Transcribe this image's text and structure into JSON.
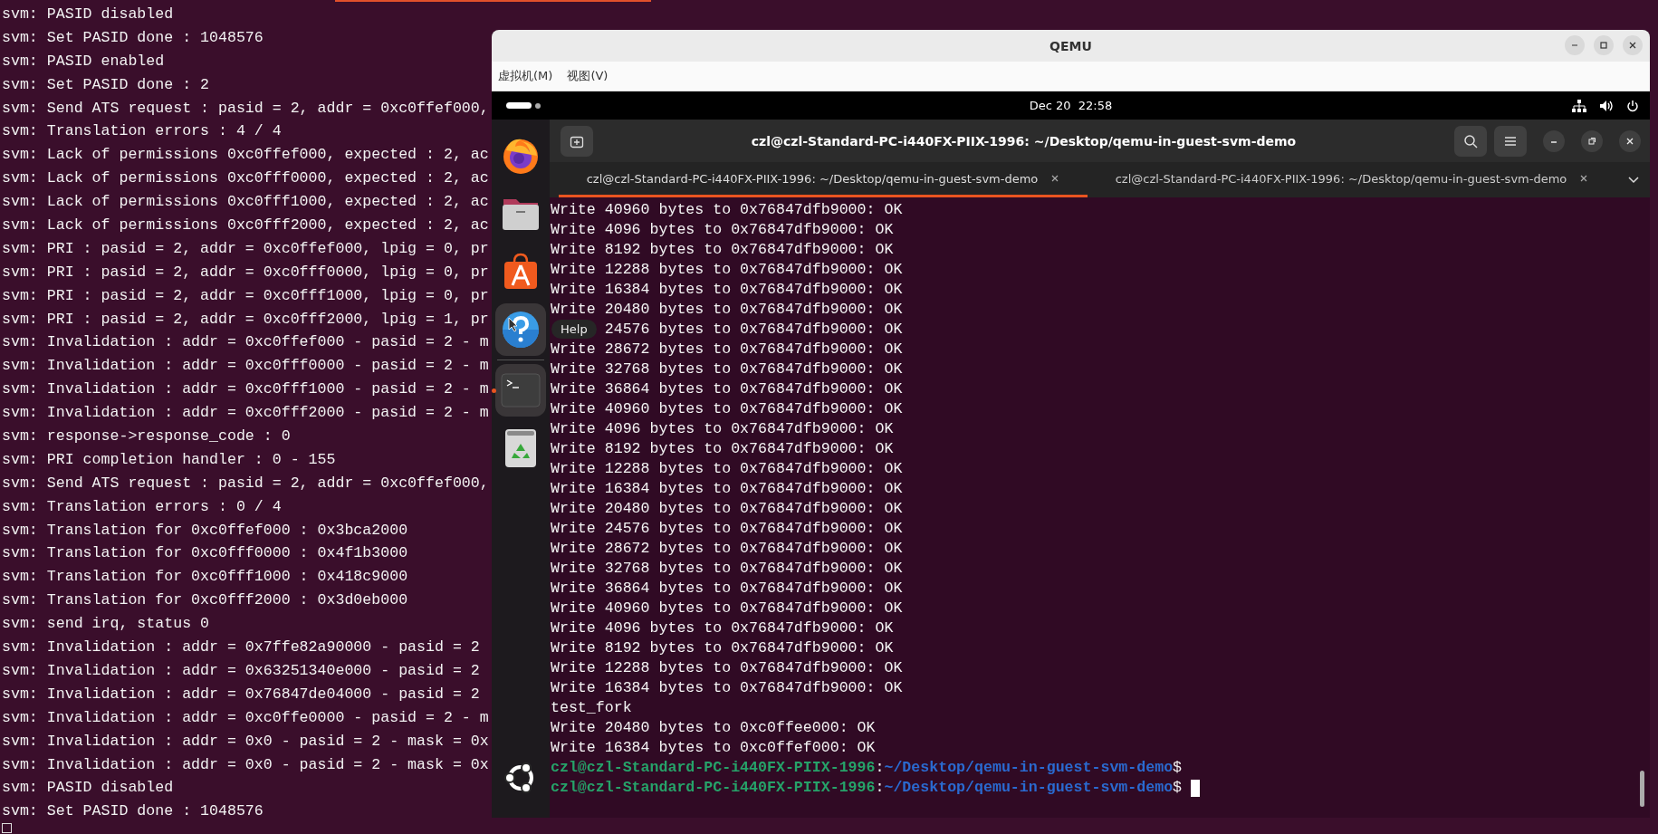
{
  "host_terminal": {
    "lines": [
      "svm: PASID disabled",
      "svm: Set PASID done : 1048576",
      "svm: PASID enabled",
      "svm: Set PASID done : 2",
      "svm: Send ATS request : pasid = 2, addr = 0xc0ffef000,",
      "svm: Translation errors : 4 / 4",
      "svm: Lack of permissions 0xc0ffef000, expected : 2, ac",
      "svm: Lack of permissions 0xc0fff0000, expected : 2, ac",
      "svm: Lack of permissions 0xc0fff1000, expected : 2, ac",
      "svm: Lack of permissions 0xc0fff2000, expected : 2, ac",
      "svm: PRI : pasid = 2, addr = 0xc0ffef000, lpig = 0, pr",
      "svm: PRI : pasid = 2, addr = 0xc0fff0000, lpig = 0, pr",
      "svm: PRI : pasid = 2, addr = 0xc0fff1000, lpig = 0, pr",
      "svm: PRI : pasid = 2, addr = 0xc0fff2000, lpig = 1, pr",
      "svm: Invalidation : addr = 0xc0ffef000 - pasid = 2 - m",
      "svm: Invalidation : addr = 0xc0fff0000 - pasid = 2 - m",
      "svm: Invalidation : addr = 0xc0fff1000 - pasid = 2 - m",
      "svm: Invalidation : addr = 0xc0fff2000 - pasid = 2 - m",
      "svm: response->response_code : 0",
      "svm: PRI completion handler : 0 - 155",
      "svm: Send ATS request : pasid = 2, addr = 0xc0ffef000,",
      "svm: Translation errors : 0 / 4",
      "svm: Translation for 0xc0ffef000 : 0x3bca2000",
      "svm: Translation for 0xc0fff0000 : 0x4f1b3000",
      "svm: Translation for 0xc0fff1000 : 0x418c9000",
      "svm: Translation for 0xc0fff2000 : 0x3d0eb000",
      "svm: send irq, status 0",
      "svm: Invalidation : addr = 0x7ffe82a90000 - pasid = 2",
      "svm: Invalidation : addr = 0x63251340e000 - pasid = 2",
      "svm: Invalidation : addr = 0x76847de04000 - pasid = 2",
      "svm: Invalidation : addr = 0xc0ffe0000 - pasid = 2 - m",
      "svm: Invalidation : addr = 0x0 - pasid = 2 - mask = 0x",
      "svm: Invalidation : addr = 0x0 - pasid = 2 - mask = 0x",
      "svm: PASID disabled",
      "svm: Set PASID done : 1048576"
    ]
  },
  "qemu": {
    "title": "QEMU",
    "menu": [
      {
        "label": "虚拟机(M)"
      },
      {
        "label": "视图(V)"
      }
    ],
    "guest": {
      "clock": "Dec 20  22:58",
      "dock": [
        {
          "kind": "browser",
          "highlighted": false,
          "running": false
        },
        {
          "kind": "files",
          "highlighted": false,
          "running": false
        },
        {
          "kind": "store",
          "highlighted": false,
          "running": false
        },
        {
          "kind": "help",
          "highlighted": true,
          "running": false
        },
        {
          "kind": "terminal",
          "highlighted": true,
          "running": true
        },
        {
          "kind": "trash",
          "highlighted": false,
          "running": false
        }
      ],
      "tooltip": "Help",
      "terminal": {
        "title": "czl@czl-Standard-PC-i440FX-PIIX-1996: ~/Desktop/qemu-in-guest-svm-demo",
        "tabs": [
          {
            "label": "czl@czl-Standard-PC-i440FX-PIIX-1996: ~/Desktop/qemu-in-guest-svm-demo",
            "selected": true
          },
          {
            "label": "czl@czl-Standard-PC-i440FX-PIIX-1996: ~/Desktop/qemu-in-guest-svm-demo",
            "selected": false
          }
        ],
        "lines": [
          {
            "kind": "output",
            "text": "Write 40960 bytes to 0x76847dfb9000: OK"
          },
          {
            "kind": "output",
            "text": "Write 4096 bytes to 0x76847dfb9000: OK"
          },
          {
            "kind": "output",
            "text": "Write 8192 bytes to 0x76847dfb9000: OK"
          },
          {
            "kind": "output",
            "text": "Write 12288 bytes to 0x76847dfb9000: OK"
          },
          {
            "kind": "output",
            "text": "Write 16384 bytes to 0x76847dfb9000: OK"
          },
          {
            "kind": "output",
            "text": "Write 20480 bytes to 0x76847dfb9000: OK"
          },
          {
            "kind": "covered",
            "text": "24576 bytes to 0x76847dfb9000: OK"
          },
          {
            "kind": "output",
            "text": "Write 28672 bytes to 0x76847dfb9000: OK"
          },
          {
            "kind": "output",
            "text": "Write 32768 bytes to 0x76847dfb9000: OK"
          },
          {
            "kind": "output",
            "text": "Write 36864 bytes to 0x76847dfb9000: OK"
          },
          {
            "kind": "output",
            "text": "Write 40960 bytes to 0x76847dfb9000: OK"
          },
          {
            "kind": "output",
            "text": "Write 4096 bytes to 0x76847dfb9000: OK"
          },
          {
            "kind": "output",
            "text": "Write 8192 bytes to 0x76847dfb9000: OK"
          },
          {
            "kind": "output",
            "text": "Write 12288 bytes to 0x76847dfb9000: OK"
          },
          {
            "kind": "output",
            "text": "Write 16384 bytes to 0x76847dfb9000: OK"
          },
          {
            "kind": "output",
            "text": "Write 20480 bytes to 0x76847dfb9000: OK"
          },
          {
            "kind": "output",
            "text": "Write 24576 bytes to 0x76847dfb9000: OK"
          },
          {
            "kind": "output",
            "text": "Write 28672 bytes to 0x76847dfb9000: OK"
          },
          {
            "kind": "output",
            "text": "Write 32768 bytes to 0x76847dfb9000: OK"
          },
          {
            "kind": "output",
            "text": "Write 36864 bytes to 0x76847dfb9000: OK"
          },
          {
            "kind": "output",
            "text": "Write 40960 bytes to 0x76847dfb9000: OK"
          },
          {
            "kind": "output",
            "text": "Write 4096 bytes to 0x76847dfb9000: OK"
          },
          {
            "kind": "output",
            "text": "Write 8192 bytes to 0x76847dfb9000: OK"
          },
          {
            "kind": "output",
            "text": "Write 12288 bytes to 0x76847dfb9000: OK"
          },
          {
            "kind": "output",
            "text": "Write 16384 bytes to 0x76847dfb9000: OK"
          },
          {
            "kind": "output",
            "text": "test_fork"
          },
          {
            "kind": "output",
            "text": "Write 20480 bytes to 0xc0ffee000: OK"
          },
          {
            "kind": "output",
            "text": "Write 16384 bytes to 0xc0ffef000: OK"
          },
          {
            "kind": "prompt",
            "user_host": "czl@czl-Standard-PC-i440FX-PIIX-1996",
            "separator": ":",
            "path": "~/Desktop/qemu-in-guest-svm-demo",
            "symbol": "$",
            "cursor": false
          },
          {
            "kind": "prompt",
            "user_host": "czl@czl-Standard-PC-i440FX-PIIX-1996",
            "separator": ":",
            "path": "~/Desktop/qemu-in-guest-svm-demo",
            "symbol": "$",
            "cursor": true
          }
        ]
      }
    }
  }
}
